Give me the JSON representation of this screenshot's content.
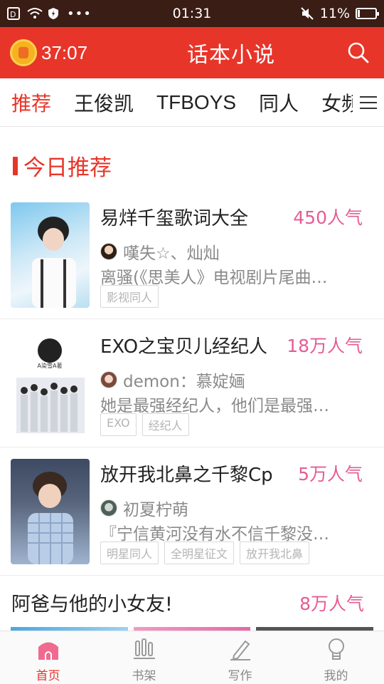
{
  "status_bar": {
    "time": "01:31",
    "battery": "11%",
    "battery_level": 0.11
  },
  "header": {
    "timer": "37:07",
    "title": "话本小说"
  },
  "tabs": [
    {
      "label": "推荐"
    },
    {
      "label": "王俊凯"
    },
    {
      "label": "TFBOYS"
    },
    {
      "label": "同人"
    },
    {
      "label": "女频"
    }
  ],
  "section_today": {
    "title": "今日推荐"
  },
  "books": [
    {
      "title": "易烊千玺歌词大全",
      "popularity": "450人气",
      "author": "嘆失☆、灿灿",
      "desc": "离骚(《思美人》电视剧片尾曲…",
      "tags": [
        "影视同人"
      ]
    },
    {
      "title": "EXO之宝贝儿经纪人",
      "popularity": "18万人气",
      "author": "demon：慕婝婳",
      "desc": "她是最强经纪人，他们是最强…",
      "tags": [
        "EXO",
        "经纪人"
      ]
    },
    {
      "title": "放开我北鼻之千黎Cp",
      "popularity": "5万人气",
      "author": "初夏柠萌",
      "desc": "『宁信黄河没有水不信千黎没…",
      "tags": [
        "明星同人",
        "全明星征文",
        "放开我北鼻"
      ]
    }
  ],
  "section_second": {
    "title": "阿爸与他的小女友!",
    "popularity": "8万人气"
  },
  "bottom_nav": [
    {
      "label": "首页",
      "icon": "home-icon"
    },
    {
      "label": "书架",
      "icon": "bookshelf-icon"
    },
    {
      "label": "写作",
      "icon": "write-icon"
    },
    {
      "label": "我的",
      "icon": "profile-icon"
    }
  ],
  "colors": {
    "accent": "#e8352a",
    "popularity": "#e45d94",
    "status_bar": "#3a1d14"
  }
}
